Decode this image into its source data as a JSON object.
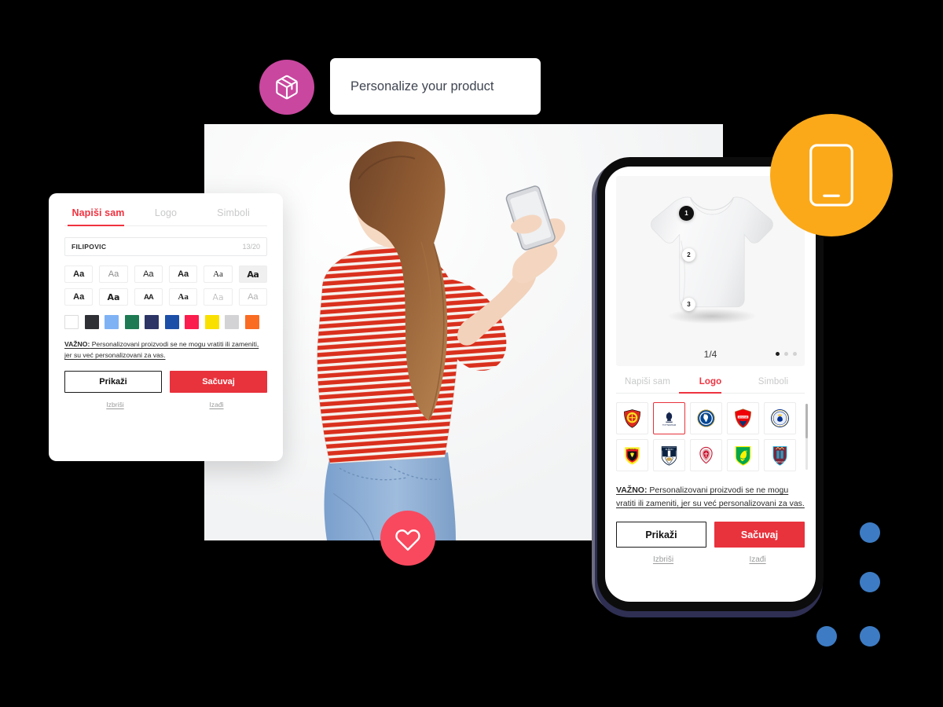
{
  "header": {
    "title": "Personalize your product",
    "badge_icon": "package-box-icon",
    "badge_color": "#c9479f"
  },
  "floating": {
    "phone_badge_icon": "mobile-phone-icon",
    "phone_badge_color": "#fba919",
    "heart_badge_icon": "heart-icon",
    "heart_badge_color": "#f9495e",
    "dot_color": "#3d7cc4"
  },
  "hero": {
    "alt": "woman-holding-phone-photo"
  },
  "desktop_panel": {
    "tabs": [
      {
        "label": "Napiši sam",
        "active": true
      },
      {
        "label": "Logo",
        "active": false
      },
      {
        "label": "Simboli",
        "active": false
      }
    ],
    "text_input": {
      "value": "FILIPOVIC",
      "placeholder": "FILIPOVIC",
      "counter": "13/20"
    },
    "font_samples": [
      [
        "Aa",
        "Aa",
        "Aa",
        "Aa",
        "Aa",
        "Aa"
      ],
      [
        "Aa",
        "Aa",
        "AA",
        "Aa",
        "Aa",
        "Aa"
      ]
    ],
    "font_selected_index": 5,
    "colors": [
      {
        "name": "white",
        "hex": "#ffffff"
      },
      {
        "name": "charcoal",
        "hex": "#2f3036"
      },
      {
        "name": "light-blue",
        "hex": "#7fb2f5"
      },
      {
        "name": "green",
        "hex": "#1d7a52"
      },
      {
        "name": "navy",
        "hex": "#2c3565"
      },
      {
        "name": "blue",
        "hex": "#1c4fa8"
      },
      {
        "name": "red",
        "hex": "#fb1d4d"
      },
      {
        "name": "yellow",
        "hex": "#f9e000"
      },
      {
        "name": "light-gray",
        "hex": "#d3d3d5"
      },
      {
        "name": "orange",
        "hex": "#f96c22"
      }
    ],
    "notice_bold": "VAŽNO:",
    "notice_text": " Personalizovani proizvodi se ne mogu vratiti ili zameniti, jer su već personalizovani za vas.",
    "buttons": {
      "preview": "Prikaži",
      "save": "Sačuvaj",
      "save_color": "#e8323c"
    },
    "links": {
      "delete": "Izbriši",
      "exit": "Izađi"
    }
  },
  "phone_panel": {
    "product": {
      "name": "white-tshirt-back",
      "counter": "1/4",
      "markers": [
        "1",
        "2",
        "3"
      ],
      "carousel_dots": 3,
      "carousel_active": 0
    },
    "tabs": [
      {
        "label": "Napiši sam",
        "active": false
      },
      {
        "label": "Logo",
        "active": true
      },
      {
        "label": "Simboli",
        "active": false
      }
    ],
    "logos": [
      {
        "name": "manchester-united-crest",
        "selected": false
      },
      {
        "name": "tottenham-hotspur-crest",
        "selected": true
      },
      {
        "name": "chelsea-crest",
        "selected": false
      },
      {
        "name": "arsenal-crest",
        "selected": false
      },
      {
        "name": "leicester-city-crest",
        "selected": false
      },
      {
        "name": "watford-crest",
        "selected": false
      },
      {
        "name": "west-bromwich-albion-crest",
        "selected": false
      },
      {
        "name": "liverpool-crest",
        "selected": false
      },
      {
        "name": "norwich-city-crest",
        "selected": false
      },
      {
        "name": "west-ham-united-crest",
        "selected": false
      }
    ],
    "notice_bold": "VAŽNO:",
    "notice_text": " Personalizovani proizvodi se ne mogu vratiti ili zameniti, jer su već personalizovani za vas.",
    "buttons": {
      "preview": "Prikaži",
      "save": "Sačuvaj",
      "save_color": "#e8323c"
    },
    "links": {
      "delete": "Izbriši",
      "exit": "Izađi"
    }
  }
}
